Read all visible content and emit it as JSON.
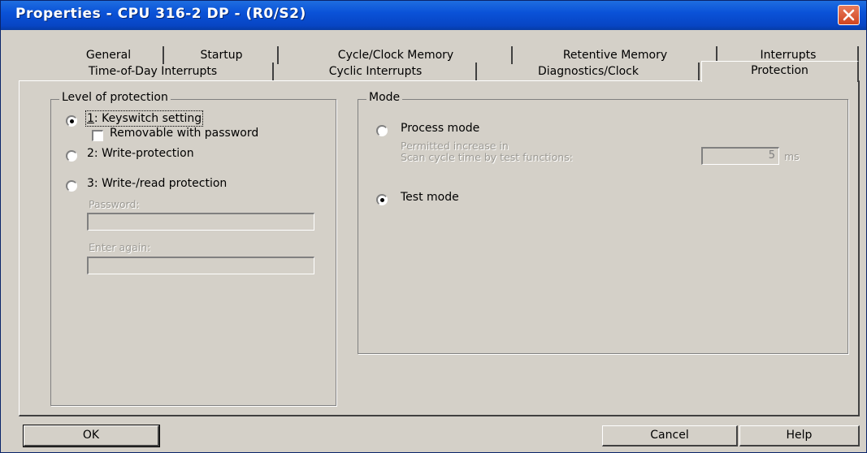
{
  "window": {
    "title": "Properties - CPU 316-2 DP - (R0/S2)"
  },
  "tabs": {
    "row1": [
      "General",
      "Startup",
      "Cycle/Clock Memory",
      "Retentive Memory",
      "Interrupts"
    ],
    "row2": [
      "Time-of-Day Interrupts",
      "Cyclic Interrupts",
      "Diagnostics/Clock",
      "Protection"
    ],
    "active": "Protection"
  },
  "protection": {
    "title": "Level of protection",
    "keyswitch": {
      "label": "1: Keyswitch setting",
      "selected": true
    },
    "removable": {
      "label": "Removable with password",
      "checked": false
    },
    "write": {
      "label": "2: Write-protection",
      "selected": false
    },
    "write_read": {
      "label": "3: Write-/read protection",
      "selected": false
    },
    "password_label": "Password:",
    "password_value": "",
    "enter_again_label": "Enter again:",
    "enter_again_value": ""
  },
  "mode": {
    "title": "Mode",
    "process": {
      "label": "Process mode",
      "selected": false
    },
    "permitted_line1": "Permitted increase in",
    "permitted_line2": "Scan cycle time by test functions:",
    "scan_value": "5",
    "scan_unit": "ms",
    "test": {
      "label": "Test mode",
      "selected": true
    }
  },
  "buttons": {
    "ok": "OK",
    "cancel": "Cancel",
    "help": "Help"
  },
  "colors": {
    "titlebar": "#0a52d8",
    "dialog_bg": "#d4d0c8",
    "close": "#d0441f"
  }
}
